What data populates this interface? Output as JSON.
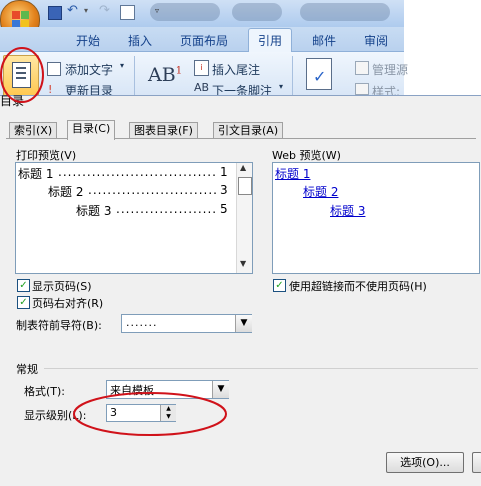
{
  "ribbon": {
    "tabs": [
      "开始",
      "插入",
      "页面布局",
      "引用",
      "邮件",
      "审阅"
    ],
    "active_tab": "引用",
    "toc_group": {
      "add_text": "添加文字",
      "update_toc": "更新目录"
    },
    "footnote_group": {
      "insert_endnote": "插入尾注",
      "next_footnote": "下一条脚注"
    },
    "right_items": {
      "manage": "管理源",
      "style": "样式:"
    }
  },
  "dialog": {
    "title": "目录",
    "tabs": [
      "索引(X)",
      "目录(C)",
      "图表目录(F)",
      "引文目录(A)"
    ],
    "active_tab": "目录(C)",
    "print_preview": {
      "label": "打印预览(V)",
      "entries": [
        {
          "text": "标题 1",
          "page": "1"
        },
        {
          "text": "标题 2",
          "page": "3"
        },
        {
          "text": "标题 3",
          "page": "5"
        }
      ]
    },
    "web_preview": {
      "label": "Web 预览(W)",
      "entries": [
        "标题 1",
        "标题 2",
        "标题 3"
      ]
    },
    "options": {
      "show_page_numbers": "显示页码(S)",
      "right_align": "页码右对齐(R)",
      "tab_leader_label": "制表符前导符(B):",
      "tab_leader_value": ".......",
      "use_hyperlinks": "使用超链接而不使用页码(H)"
    },
    "general": {
      "label": "常规",
      "format_label": "格式(T):",
      "format_value": "来自模板",
      "levels_label": "显示级别(L):",
      "levels_value": "3"
    },
    "buttons": {
      "options": "选项(O)..."
    }
  },
  "colors": {
    "annotation": "#d0121a",
    "link": "#0000cc",
    "ribbon_text": "#15428b"
  }
}
